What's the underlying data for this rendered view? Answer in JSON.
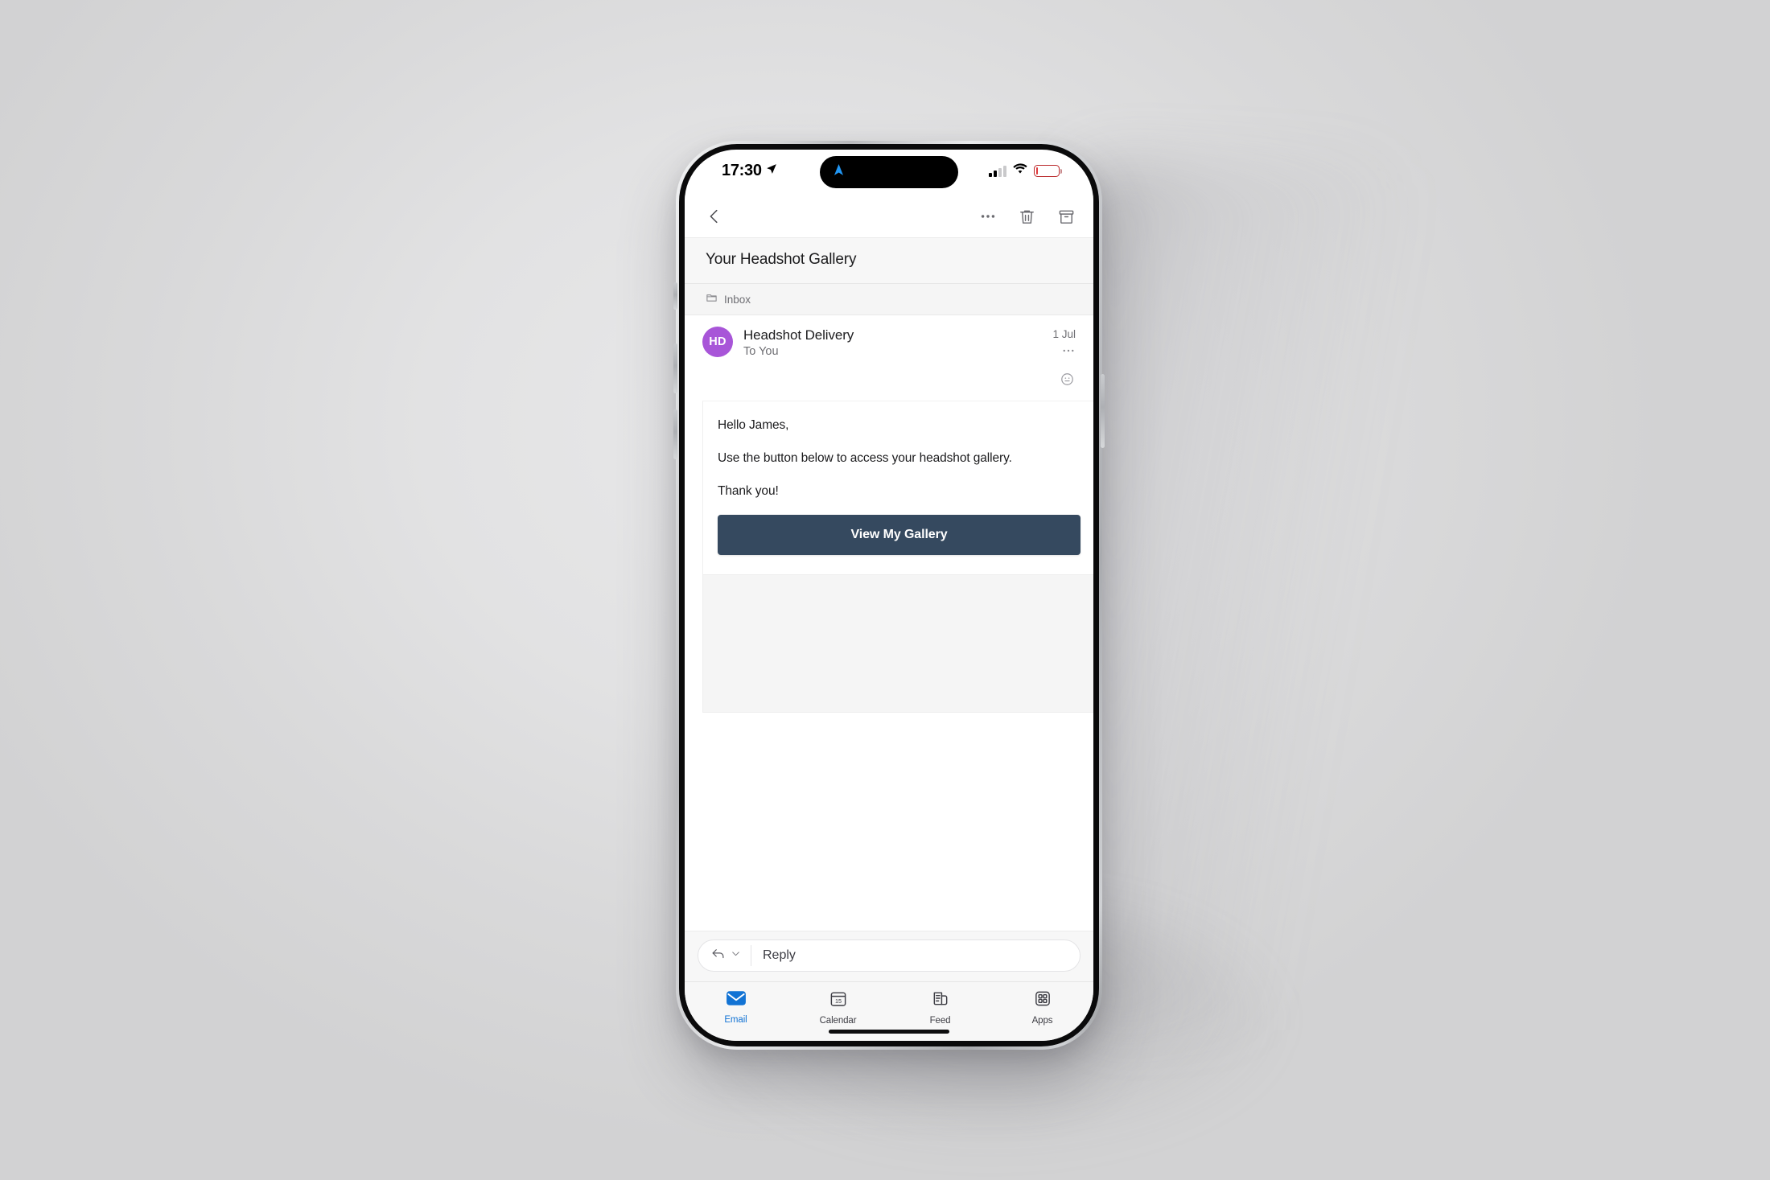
{
  "status_bar": {
    "time": "17:30",
    "location_icon": "location-arrow-icon",
    "island_icon": "navigation-arrow-icon",
    "signal_icon": "cellular-signal-icon",
    "signal_bars_filled": 2,
    "signal_bars_total": 4,
    "wifi_icon": "wifi-icon",
    "battery_icon": "battery-low-icon",
    "battery_level_percent": 8,
    "battery_color": "#e0393c",
    "island_accent": "#2196f3"
  },
  "toolbar": {
    "back_icon": "chevron-left-icon",
    "more_icon": "ellipsis-icon",
    "delete_icon": "trash-icon",
    "archive_icon": "archive-icon"
  },
  "email": {
    "subject": "Your Headshot Gallery",
    "folder_icon": "folder-icon",
    "folder": "Inbox",
    "sender_initials": "HD",
    "sender_avatar_color": "#a855d8",
    "sender_name": "Headshot Delivery",
    "recipient": "To You",
    "date": "1 Jul",
    "more_icon": "ellipsis-icon",
    "reaction_icon": "smiley-face-icon",
    "body": {
      "greeting": "Hello James,",
      "paragraph": "Use the button below to access your headshot gallery.",
      "closing": "Thank you!",
      "cta_label": "View My Gallery",
      "cta_color": "#35495f"
    }
  },
  "reply": {
    "reply_icon": "reply-arrow-icon",
    "chevron_icon": "chevron-down-icon",
    "placeholder": "Reply"
  },
  "tab_bar": {
    "active_color": "#1273d4",
    "items": [
      {
        "label": "Email",
        "icon": "envelope-icon",
        "active": true
      },
      {
        "label": "Calendar",
        "icon": "calendar-icon",
        "day": "15",
        "active": false
      },
      {
        "label": "Feed",
        "icon": "feed-icon",
        "active": false
      },
      {
        "label": "Apps",
        "icon": "apps-grid-icon",
        "active": false
      }
    ]
  }
}
